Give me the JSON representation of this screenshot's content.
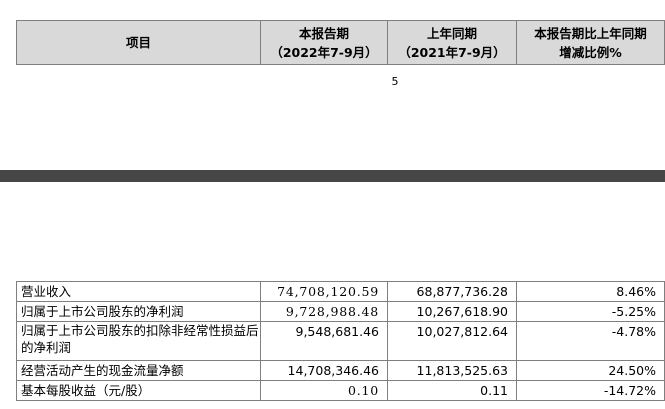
{
  "header": {
    "col_item": "项目",
    "col_current": {
      "line1": "本报告期",
      "line2": "（2022年7-9月）"
    },
    "col_prior": {
      "line1": "上年同期",
      "line2": "（2021年7-9月）"
    },
    "col_change": {
      "line1": "本报告期比上年同期",
      "line2": "增减比例%"
    }
  },
  "page_number": "5",
  "rows": [
    {
      "label": "营业收入",
      "current": "74,708,120.59",
      "prior": "68,877,736.28",
      "change": "8.46%"
    },
    {
      "label": "归属于上市公司股东的净利润",
      "current": "9,728,988.48",
      "prior": "10,267,618.90",
      "change": "-5.25%"
    },
    {
      "label": "归属于上市公司股东的扣除非经常性损益后的净利润",
      "current": "9,548,681.46",
      "prior": "10,027,812.64",
      "change": "-4.78%"
    },
    {
      "label": "经营活动产生的现金流量净额",
      "current": "14,708,346.46",
      "prior": "11,813,525.63",
      "change": "24.50%"
    },
    {
      "label": "基本每股收益（元/股）",
      "current": "0.10",
      "prior": "0.11",
      "change": "-14.72%"
    }
  ]
}
